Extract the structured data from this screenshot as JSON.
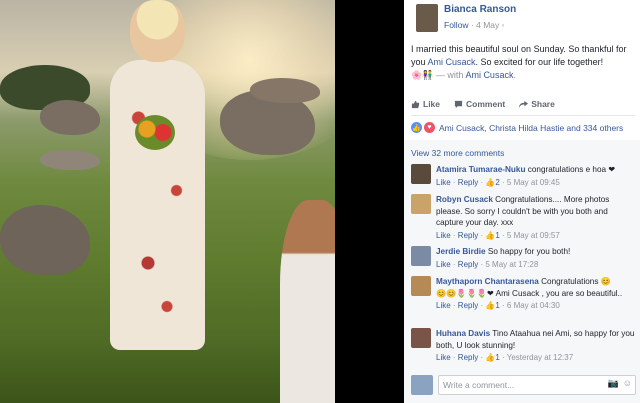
{
  "post": {
    "author": "Bianca Ranson",
    "follow": "Follow",
    "date": "4 May",
    "text_1": "I married this beautiful soul on Sunday. So thankful for you ",
    "tag_1": "Ami Cusack",
    "text_2": ". So excited for our life together!",
    "emoji": "🌸👫",
    "with_prefix": " — with ",
    "with_name": "Ami Cusack",
    "with_suffix": "."
  },
  "actions": {
    "like": "Like",
    "comment": "Comment",
    "share": "Share"
  },
  "reactions": {
    "text": "Ami Cusack, Christa Hilda Hastie and 334 others"
  },
  "comments_header": "View 32 more comments",
  "comments": [
    {
      "name": "Atamira Tumarae-Nuku",
      "text": "congratulations e hoa ❤",
      "like": "Like",
      "reply": "Reply",
      "likes": "2",
      "time": "5 May at 09:45"
    },
    {
      "name": "Robyn Cusack",
      "text": "Congratulations.... More photos please. So sorry I couldn't be with you both and capture your day. xxx",
      "like": "Like",
      "reply": "Reply",
      "likes": "1",
      "time": "5 May at 09:57"
    },
    {
      "name": "Jerdie Birdie",
      "text": "So happy for you both!",
      "like": "Like",
      "reply": "Reply",
      "likes": "",
      "time": "5 May at 17:28"
    },
    {
      "name": "Maythaporn Chantarasena",
      "text": "Congratulations 😊",
      "text2": "😊😊🌷🌷🌷❤ Ami Cusack , you are so beautiful..",
      "like": "Like",
      "reply": "Reply",
      "likes": "1",
      "time": "6 May at 04:30"
    },
    {
      "name": "Huhana Davis",
      "text": "Tino Ataahua nei Ami, so happy for you both, U look stunning!",
      "like": "Like",
      "reply": "Reply",
      "likes": "1",
      "time": "Yesterday at 12:37"
    }
  ],
  "composer": {
    "placeholder": "Write a comment...",
    "camera_icon": "camera-icon",
    "emoji_icon": "smile-icon"
  },
  "colors": {
    "link": "#365899",
    "meta": "#90949c",
    "like_blue": "#5890ff",
    "love_red": "#f25268"
  }
}
